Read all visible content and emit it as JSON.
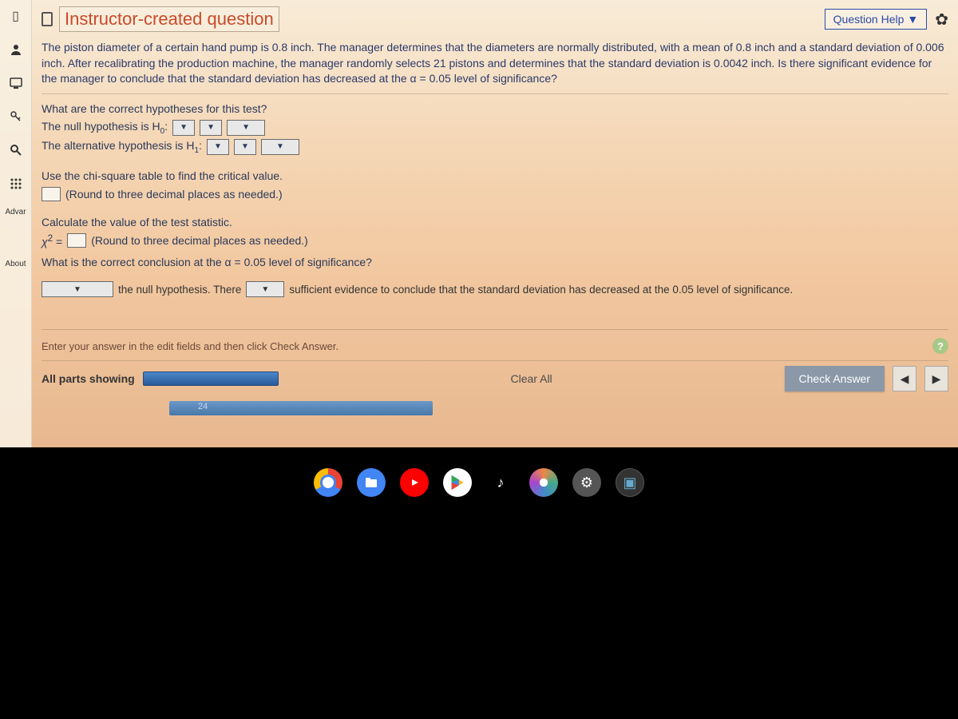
{
  "header": {
    "title": "Instructor-created question",
    "help_label": "Question Help"
  },
  "sidebar": {
    "labels": {
      "advanced": "Advar",
      "about": "About"
    }
  },
  "problem_text": "The piston diameter of a certain hand pump is 0.8 inch. The manager determines that the diameters are normally distributed, with a mean of 0.8 inch and a standard deviation of 0.006 inch. After recalibrating the production machine, the manager randomly selects 21 pistons and determines that the standard deviation is 0.0042 inch. Is there significant evidence for the manager to conclude that the standard deviation has decreased at the α = 0.05 level of significance?",
  "q1": {
    "prompt": "What are the correct hypotheses for this test?",
    "null_label": "The null hypothesis is H",
    "null_sub": "0",
    "alt_label": "The alternative hypothesis is H",
    "alt_sub": "1"
  },
  "q2": {
    "prompt": "Use the chi-square table to find the critical value.",
    "hint": "(Round to three decimal places as needed.)"
  },
  "q3": {
    "prompt": "Calculate the value of the test statistic.",
    "stat_label": "χ",
    "stat_sup": "2",
    "equals": " = ",
    "hint": "(Round to three decimal places as needed.)"
  },
  "q4": {
    "prompt": "What is the correct conclusion at the α = 0.05 level of significance?",
    "mid1": " the null hypothesis. There ",
    "mid2": " sufficient evidence to conclude that the standard deviation has decreased at the 0.05 level of significance."
  },
  "footer": {
    "instruction": "Enter your answer in the edit fields and then click Check Answer.",
    "parts": "All parts showing",
    "clear": "Clear All",
    "check": "Check Answer"
  },
  "taskbar_time": "24"
}
